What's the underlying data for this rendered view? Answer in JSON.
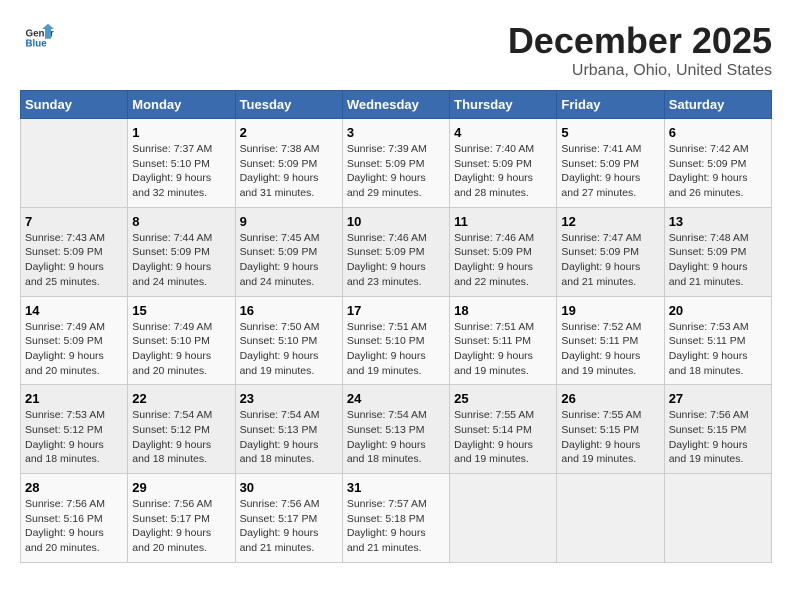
{
  "logo": {
    "general": "General",
    "blue": "Blue"
  },
  "title": "December 2025",
  "subtitle": "Urbana, Ohio, United States",
  "days_of_week": [
    "Sunday",
    "Monday",
    "Tuesday",
    "Wednesday",
    "Thursday",
    "Friday",
    "Saturday"
  ],
  "weeks": [
    [
      {
        "day": "",
        "info": ""
      },
      {
        "day": "1",
        "info": "Sunrise: 7:37 AM\nSunset: 5:10 PM\nDaylight: 9 hours\nand 32 minutes."
      },
      {
        "day": "2",
        "info": "Sunrise: 7:38 AM\nSunset: 5:09 PM\nDaylight: 9 hours\nand 31 minutes."
      },
      {
        "day": "3",
        "info": "Sunrise: 7:39 AM\nSunset: 5:09 PM\nDaylight: 9 hours\nand 29 minutes."
      },
      {
        "day": "4",
        "info": "Sunrise: 7:40 AM\nSunset: 5:09 PM\nDaylight: 9 hours\nand 28 minutes."
      },
      {
        "day": "5",
        "info": "Sunrise: 7:41 AM\nSunset: 5:09 PM\nDaylight: 9 hours\nand 27 minutes."
      },
      {
        "day": "6",
        "info": "Sunrise: 7:42 AM\nSunset: 5:09 PM\nDaylight: 9 hours\nand 26 minutes."
      }
    ],
    [
      {
        "day": "7",
        "info": "Sunrise: 7:43 AM\nSunset: 5:09 PM\nDaylight: 9 hours\nand 25 minutes."
      },
      {
        "day": "8",
        "info": "Sunrise: 7:44 AM\nSunset: 5:09 PM\nDaylight: 9 hours\nand 24 minutes."
      },
      {
        "day": "9",
        "info": "Sunrise: 7:45 AM\nSunset: 5:09 PM\nDaylight: 9 hours\nand 24 minutes."
      },
      {
        "day": "10",
        "info": "Sunrise: 7:46 AM\nSunset: 5:09 PM\nDaylight: 9 hours\nand 23 minutes."
      },
      {
        "day": "11",
        "info": "Sunrise: 7:46 AM\nSunset: 5:09 PM\nDaylight: 9 hours\nand 22 minutes."
      },
      {
        "day": "12",
        "info": "Sunrise: 7:47 AM\nSunset: 5:09 PM\nDaylight: 9 hours\nand 21 minutes."
      },
      {
        "day": "13",
        "info": "Sunrise: 7:48 AM\nSunset: 5:09 PM\nDaylight: 9 hours\nand 21 minutes."
      }
    ],
    [
      {
        "day": "14",
        "info": "Sunrise: 7:49 AM\nSunset: 5:09 PM\nDaylight: 9 hours\nand 20 minutes."
      },
      {
        "day": "15",
        "info": "Sunrise: 7:49 AM\nSunset: 5:10 PM\nDaylight: 9 hours\nand 20 minutes."
      },
      {
        "day": "16",
        "info": "Sunrise: 7:50 AM\nSunset: 5:10 PM\nDaylight: 9 hours\nand 19 minutes."
      },
      {
        "day": "17",
        "info": "Sunrise: 7:51 AM\nSunset: 5:10 PM\nDaylight: 9 hours\nand 19 minutes."
      },
      {
        "day": "18",
        "info": "Sunrise: 7:51 AM\nSunset: 5:11 PM\nDaylight: 9 hours\nand 19 minutes."
      },
      {
        "day": "19",
        "info": "Sunrise: 7:52 AM\nSunset: 5:11 PM\nDaylight: 9 hours\nand 19 minutes."
      },
      {
        "day": "20",
        "info": "Sunrise: 7:53 AM\nSunset: 5:11 PM\nDaylight: 9 hours\nand 18 minutes."
      }
    ],
    [
      {
        "day": "21",
        "info": "Sunrise: 7:53 AM\nSunset: 5:12 PM\nDaylight: 9 hours\nand 18 minutes."
      },
      {
        "day": "22",
        "info": "Sunrise: 7:54 AM\nSunset: 5:12 PM\nDaylight: 9 hours\nand 18 minutes."
      },
      {
        "day": "23",
        "info": "Sunrise: 7:54 AM\nSunset: 5:13 PM\nDaylight: 9 hours\nand 18 minutes."
      },
      {
        "day": "24",
        "info": "Sunrise: 7:54 AM\nSunset: 5:13 PM\nDaylight: 9 hours\nand 18 minutes."
      },
      {
        "day": "25",
        "info": "Sunrise: 7:55 AM\nSunset: 5:14 PM\nDaylight: 9 hours\nand 19 minutes."
      },
      {
        "day": "26",
        "info": "Sunrise: 7:55 AM\nSunset: 5:15 PM\nDaylight: 9 hours\nand 19 minutes."
      },
      {
        "day": "27",
        "info": "Sunrise: 7:56 AM\nSunset: 5:15 PM\nDaylight: 9 hours\nand 19 minutes."
      }
    ],
    [
      {
        "day": "28",
        "info": "Sunrise: 7:56 AM\nSunset: 5:16 PM\nDaylight: 9 hours\nand 20 minutes."
      },
      {
        "day": "29",
        "info": "Sunrise: 7:56 AM\nSunset: 5:17 PM\nDaylight: 9 hours\nand 20 minutes."
      },
      {
        "day": "30",
        "info": "Sunrise: 7:56 AM\nSunset: 5:17 PM\nDaylight: 9 hours\nand 21 minutes."
      },
      {
        "day": "31",
        "info": "Sunrise: 7:57 AM\nSunset: 5:18 PM\nDaylight: 9 hours\nand 21 minutes."
      },
      {
        "day": "",
        "info": ""
      },
      {
        "day": "",
        "info": ""
      },
      {
        "day": "",
        "info": ""
      }
    ]
  ]
}
